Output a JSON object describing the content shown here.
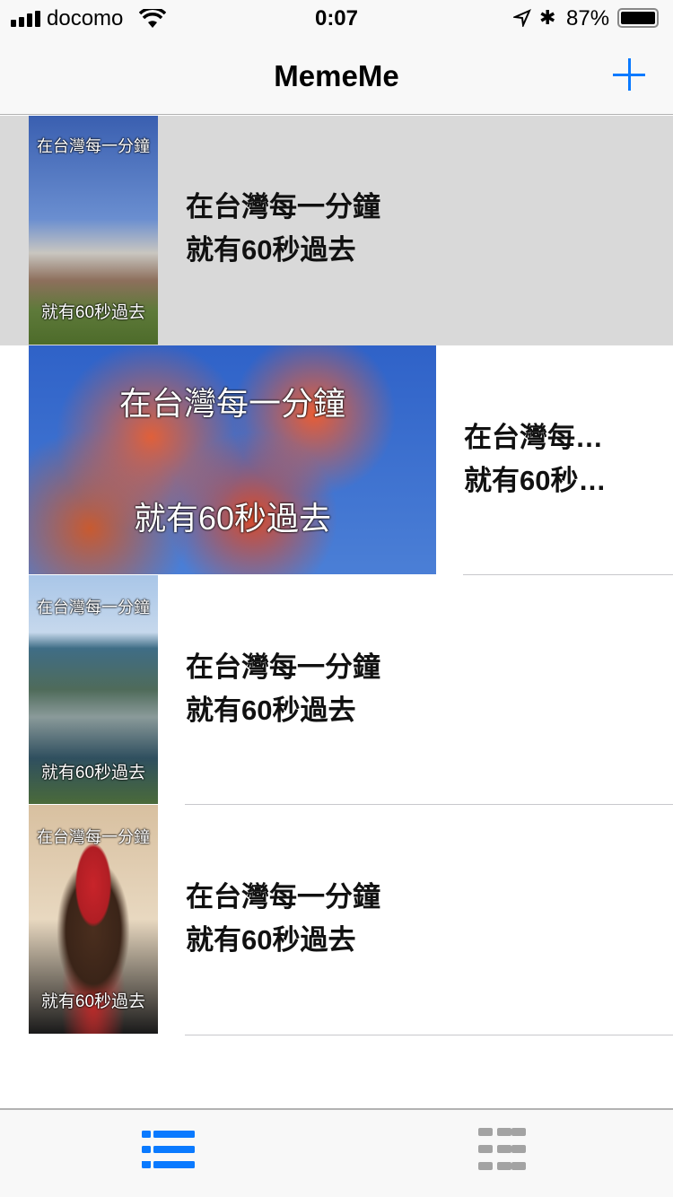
{
  "status": {
    "carrier": "docomo",
    "time": "0:07",
    "battery": "87%"
  },
  "nav": {
    "title": "MemeMe",
    "add_icon": "plus-icon"
  },
  "memes": [
    {
      "top_text": "在台灣每一分鐘",
      "bottom_text": "就有60秒過去",
      "label_top": "在台灣每一分鐘",
      "label_bottom": "就有60秒過去",
      "selected": true
    },
    {
      "top_text": "在台灣每一分鐘",
      "bottom_text": "就有60秒過去",
      "label_top": "在台灣每…",
      "label_bottom": "就有60秒…",
      "selected": false
    },
    {
      "top_text": "在台灣每一分鐘",
      "bottom_text": "就有60秒過去",
      "label_top": "在台灣每一分鐘",
      "label_bottom": "就有60秒過去",
      "selected": false
    },
    {
      "top_text": "在台灣每一分鐘",
      "bottom_text": "就有60秒過去",
      "label_top": "在台灣每一分鐘",
      "label_bottom": "就有60秒過去",
      "selected": false
    }
  ],
  "tabs": [
    {
      "icon": "list-icon",
      "active": true,
      "color": "#0a7aff"
    },
    {
      "icon": "grid-icon",
      "active": false,
      "color": "#a3a3a3"
    }
  ]
}
